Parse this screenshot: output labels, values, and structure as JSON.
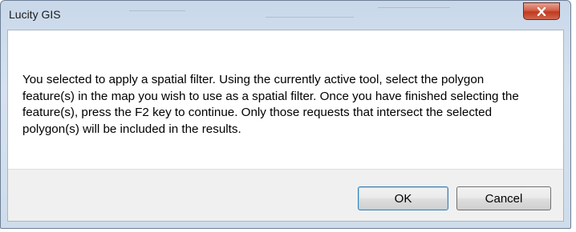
{
  "window": {
    "title": "Lucity GIS"
  },
  "dialog": {
    "message": "You selected to apply a spatial filter.  Using the currently active tool, select the polygon feature(s) in the map you wish to use as a spatial filter.  Once you have finished selecting the feature(s), press the F2 key to continue.  Only those requests that intersect the selected polygon(s) will be included in the results."
  },
  "buttons": {
    "ok_label": "OK",
    "cancel_label": "Cancel"
  },
  "icons": {
    "close": "close-icon"
  },
  "colors": {
    "close_button": "#c7432a",
    "default_button_border": "#3c7fb1"
  }
}
